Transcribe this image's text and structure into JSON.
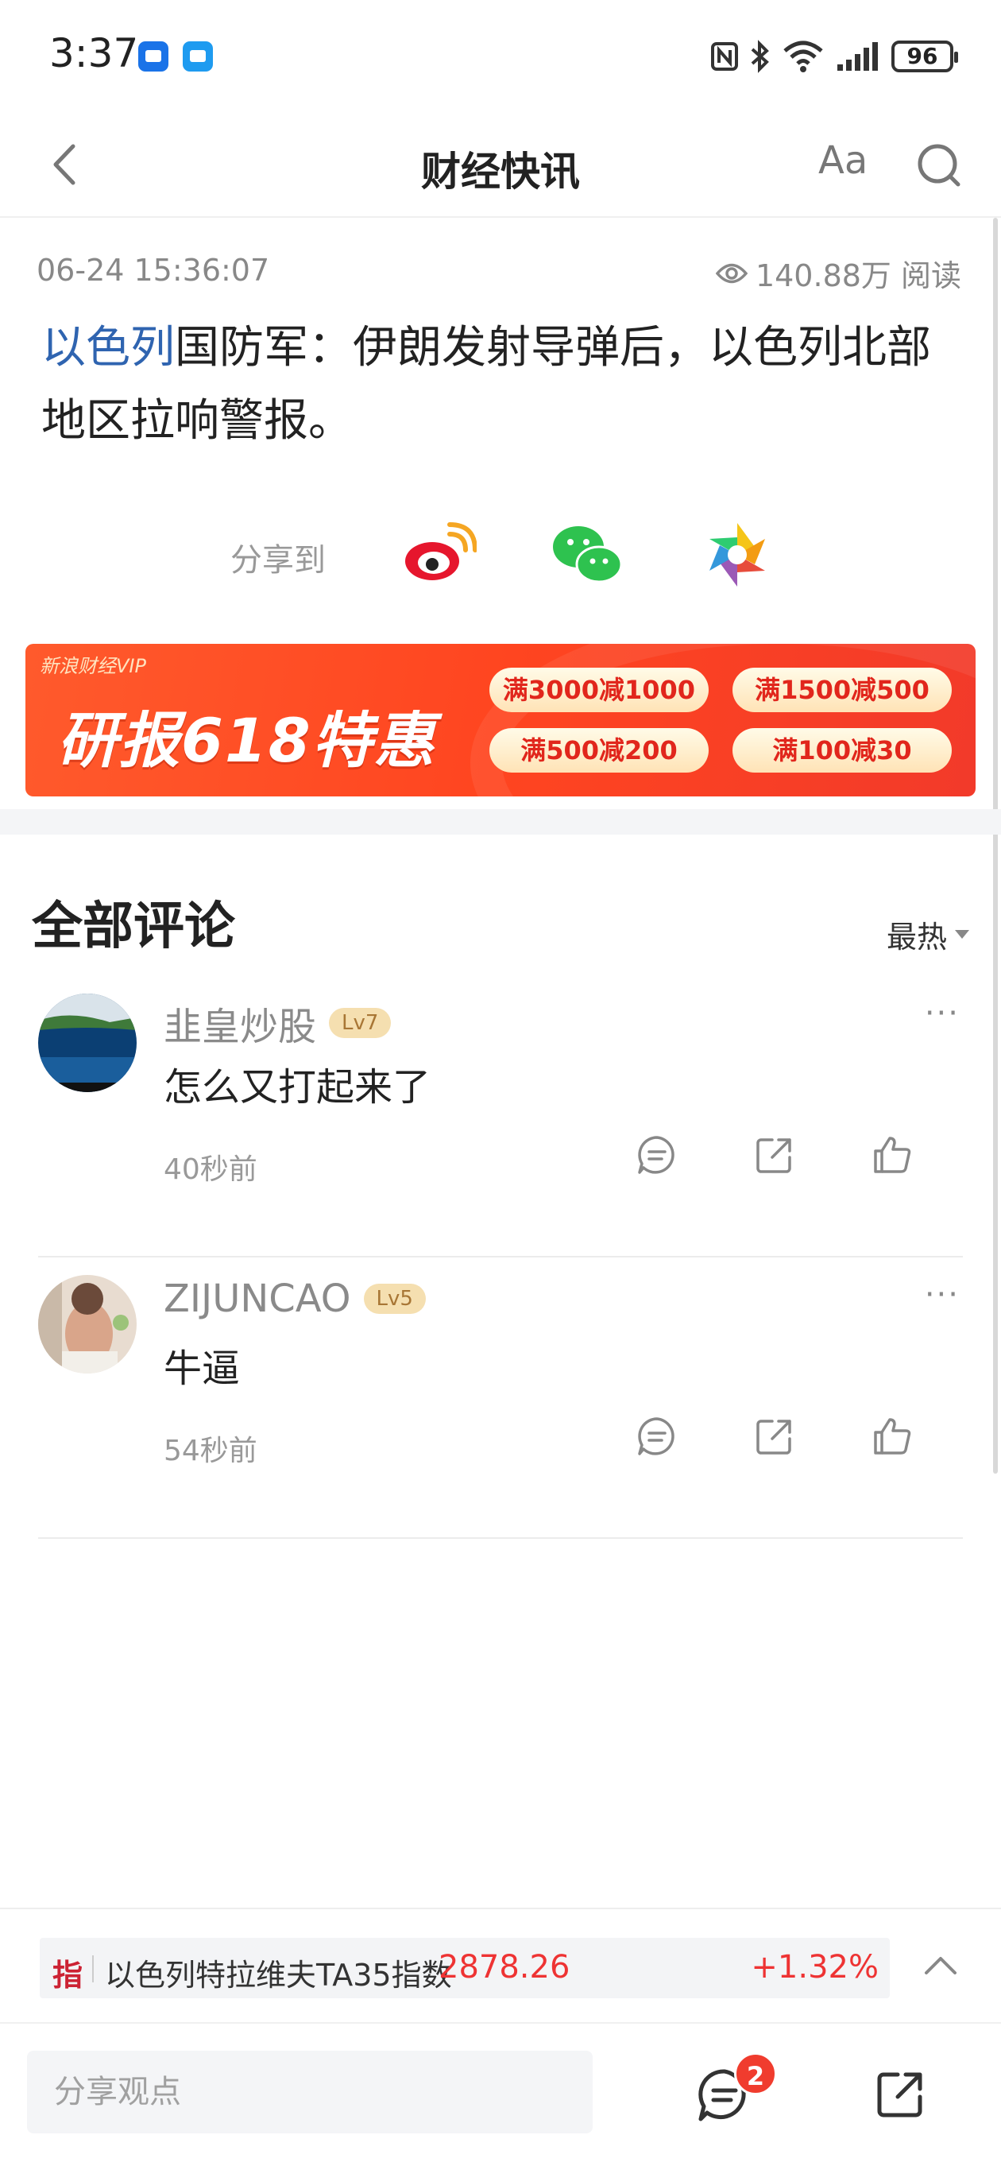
{
  "status": {
    "time": "3:37",
    "battery": "96"
  },
  "header": {
    "title": "财经快讯",
    "font_button": "Aa"
  },
  "article": {
    "datetime": "06-24 15:36:07",
    "views": "140.88万 阅读",
    "tag": "以色列",
    "body": "国防军：伊朗发射导弹后，以色列北部地区拉响警报。"
  },
  "share": {
    "label": "分享到",
    "targets": [
      "weibo-icon",
      "wechat-icon",
      "moments-icon"
    ]
  },
  "banner": {
    "brand": "新浪财经VIP",
    "title": "研报618特惠",
    "coupons": [
      "满3000减1000",
      "满1500减500",
      "满500减200",
      "满100减30"
    ]
  },
  "comments": {
    "title": "全部评论",
    "sort": "最热",
    "items": [
      {
        "user": "韭皇炒股",
        "level": "Lv7",
        "text": "怎么又打起来了",
        "time": "40秒前"
      },
      {
        "user": "ZIJUNCAO",
        "level": "Lv5",
        "text": "牛逼",
        "time": "54秒前"
      }
    ]
  },
  "ticker": {
    "badge": "指",
    "name": "以色列特拉维夫TA35指数",
    "price": "2878.26",
    "change": "+1.32%"
  },
  "bottom": {
    "placeholder": "分享观点",
    "comment_count": "2"
  },
  "colors": {
    "accent_link": "#2f64b0",
    "up_red": "#e33333",
    "banner_red": "#ff4520",
    "badge_red": "#f03c2e"
  }
}
